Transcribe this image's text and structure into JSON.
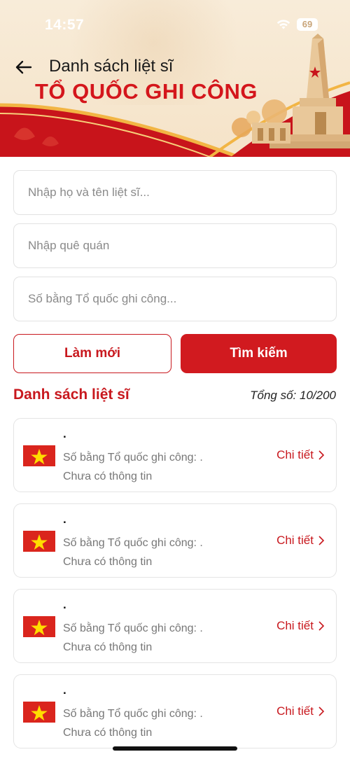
{
  "status_bar": {
    "time": "14:57",
    "battery": "69"
  },
  "header": {
    "title": "Danh sách liệt sĩ",
    "slogan": "TỔ QUỐC GHI CÔNG"
  },
  "search": {
    "name_placeholder": "Nhập họ và tên liệt sĩ...",
    "hometown_placeholder": "Nhập quê quán",
    "certificate_placeholder": "Số bằng Tổ quốc ghi công...",
    "reset_label": "Làm mới",
    "search_label": "Tìm kiếm"
  },
  "list": {
    "heading": "Danh sách liệt sĩ",
    "total": "Tổng số: 10/200",
    "items": [
      {
        "name": ".",
        "certificate": "Số bằng Tổ quốc ghi công: .",
        "info": "Chưa có thông tin",
        "detail_label": "Chi tiết"
      },
      {
        "name": ".",
        "certificate": "Số bằng Tổ quốc ghi công: .",
        "info": "Chưa có thông tin",
        "detail_label": "Chi tiết"
      },
      {
        "name": ".",
        "certificate": "Số bằng Tổ quốc ghi công: .",
        "info": "Chưa có thông tin",
        "detail_label": "Chi tiết"
      },
      {
        "name": ".",
        "certificate": "Số bằng Tổ quốc ghi công: .",
        "info": "Chưa có thông tin",
        "detail_label": "Chi tiết"
      }
    ]
  },
  "colors": {
    "accent": "#d11a1f",
    "flag_red": "#da251d",
    "flag_star": "#ffdd00",
    "banner_cream": "#f5e3c8"
  },
  "icons": {
    "back": "arrow-left-icon",
    "chevron": "chevron-right-icon",
    "flag": "vietnam-flag-icon",
    "wifi": "wifi-icon",
    "battery": "battery-icon"
  }
}
